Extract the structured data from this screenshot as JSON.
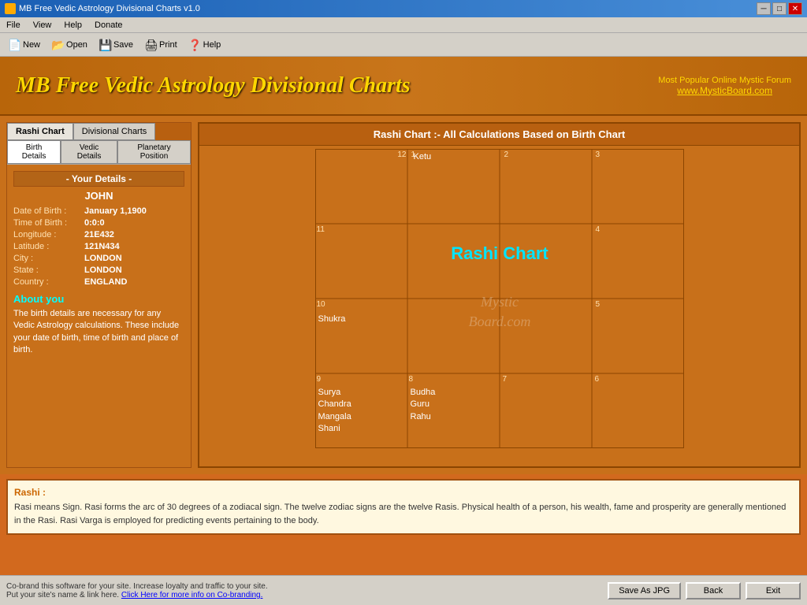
{
  "titleBar": {
    "title": "MB Free Vedic Astrology Divisional Charts v1.0",
    "buttons": [
      "minimize",
      "maximize",
      "close"
    ]
  },
  "menuBar": {
    "items": [
      "File",
      "View",
      "Help",
      "Donate"
    ]
  },
  "toolbar": {
    "new_label": "New",
    "open_label": "Open",
    "save_label": "Save",
    "print_label": "Print",
    "help_label": "Help"
  },
  "header": {
    "title": "MB Free Vedic Astrology Divisional Charts",
    "tagline": "Most Popular Online Mystic Forum",
    "link": "www.MysticBoard.com"
  },
  "leftPanel": {
    "tabs": [
      "Rashi Chart",
      "Divisional Charts"
    ],
    "subTabs": [
      "Birth Details",
      "Vedic Details",
      "Planetary Position"
    ],
    "activeTab": "Rashi Chart",
    "activeSubTab": "Birth Details",
    "detailsTitle": "- Your Details -",
    "userName": "JOHN",
    "fields": [
      {
        "label": "Date of Birth :",
        "value": "January 1,1900"
      },
      {
        "label": "Time of Birth :",
        "value": "0:0:0"
      },
      {
        "label": "Longitude :",
        "value": "21E432"
      },
      {
        "label": "Latitude :",
        "value": "121N434"
      },
      {
        "label": "City :",
        "value": "LONDON"
      },
      {
        "label": "State :",
        "value": "LONDON"
      },
      {
        "label": "Country :",
        "value": "ENGLAND"
      }
    ],
    "aboutTitle": "About you",
    "aboutText": "The birth details are necessary for any Vedic Astrology calculations. These include your date of birth, time of birth and place of birth."
  },
  "chart": {
    "title": "Rashi Chart :- All Calculations Based on Birth Chart",
    "centerLabel": "Rashi Chart",
    "watermark": "MysticBoard.com",
    "cells": [
      {
        "num": "12",
        "pos": "top-left-1",
        "planets": []
      },
      {
        "num": "1",
        "pos": "top-2",
        "planets": [
          "Ketu"
        ]
      },
      {
        "num": "2",
        "pos": "top-3",
        "planets": []
      },
      {
        "num": "3",
        "pos": "top-right",
        "planets": []
      },
      {
        "num": "11",
        "pos": "mid-left",
        "planets": []
      },
      {
        "num": "4",
        "pos": "mid-right",
        "planets": []
      },
      {
        "num": "10",
        "pos": "bot-left-1",
        "planets": [
          "Shukra"
        ]
      },
      {
        "num": "5",
        "pos": "bot-right-1",
        "planets": []
      },
      {
        "num": "9",
        "pos": "bot-2",
        "planets": [
          "Surya",
          "Chandra",
          "Mangala",
          "Shani"
        ]
      },
      {
        "num": "8",
        "pos": "bot-3",
        "planets": [
          "Budha",
          "Guru",
          "Rahu"
        ]
      },
      {
        "num": "7",
        "pos": "bot-4",
        "planets": []
      },
      {
        "num": "6",
        "pos": "bot-right-2",
        "planets": []
      }
    ]
  },
  "description": {
    "title": "Rashi :",
    "text": "Rasi means Sign. Rasi forms the arc of 30 degrees of a zodiacal sign. The twelve zodiac signs are the twelve Rasis. Physical health of a person, his wealth, fame and prosperity are generally mentioned in the Rasi. Rasi Varga is employed for predicting events pertaining to the body."
  },
  "statusBar": {
    "text1": "Co-brand this software for your site. Increase loyalty and traffic to your site.",
    "text2": "Put your site's name & link here.",
    "linkText": "Click Here for more info on Co-branding.",
    "buttons": [
      "Save As JPG",
      "Back",
      "Exit"
    ]
  }
}
